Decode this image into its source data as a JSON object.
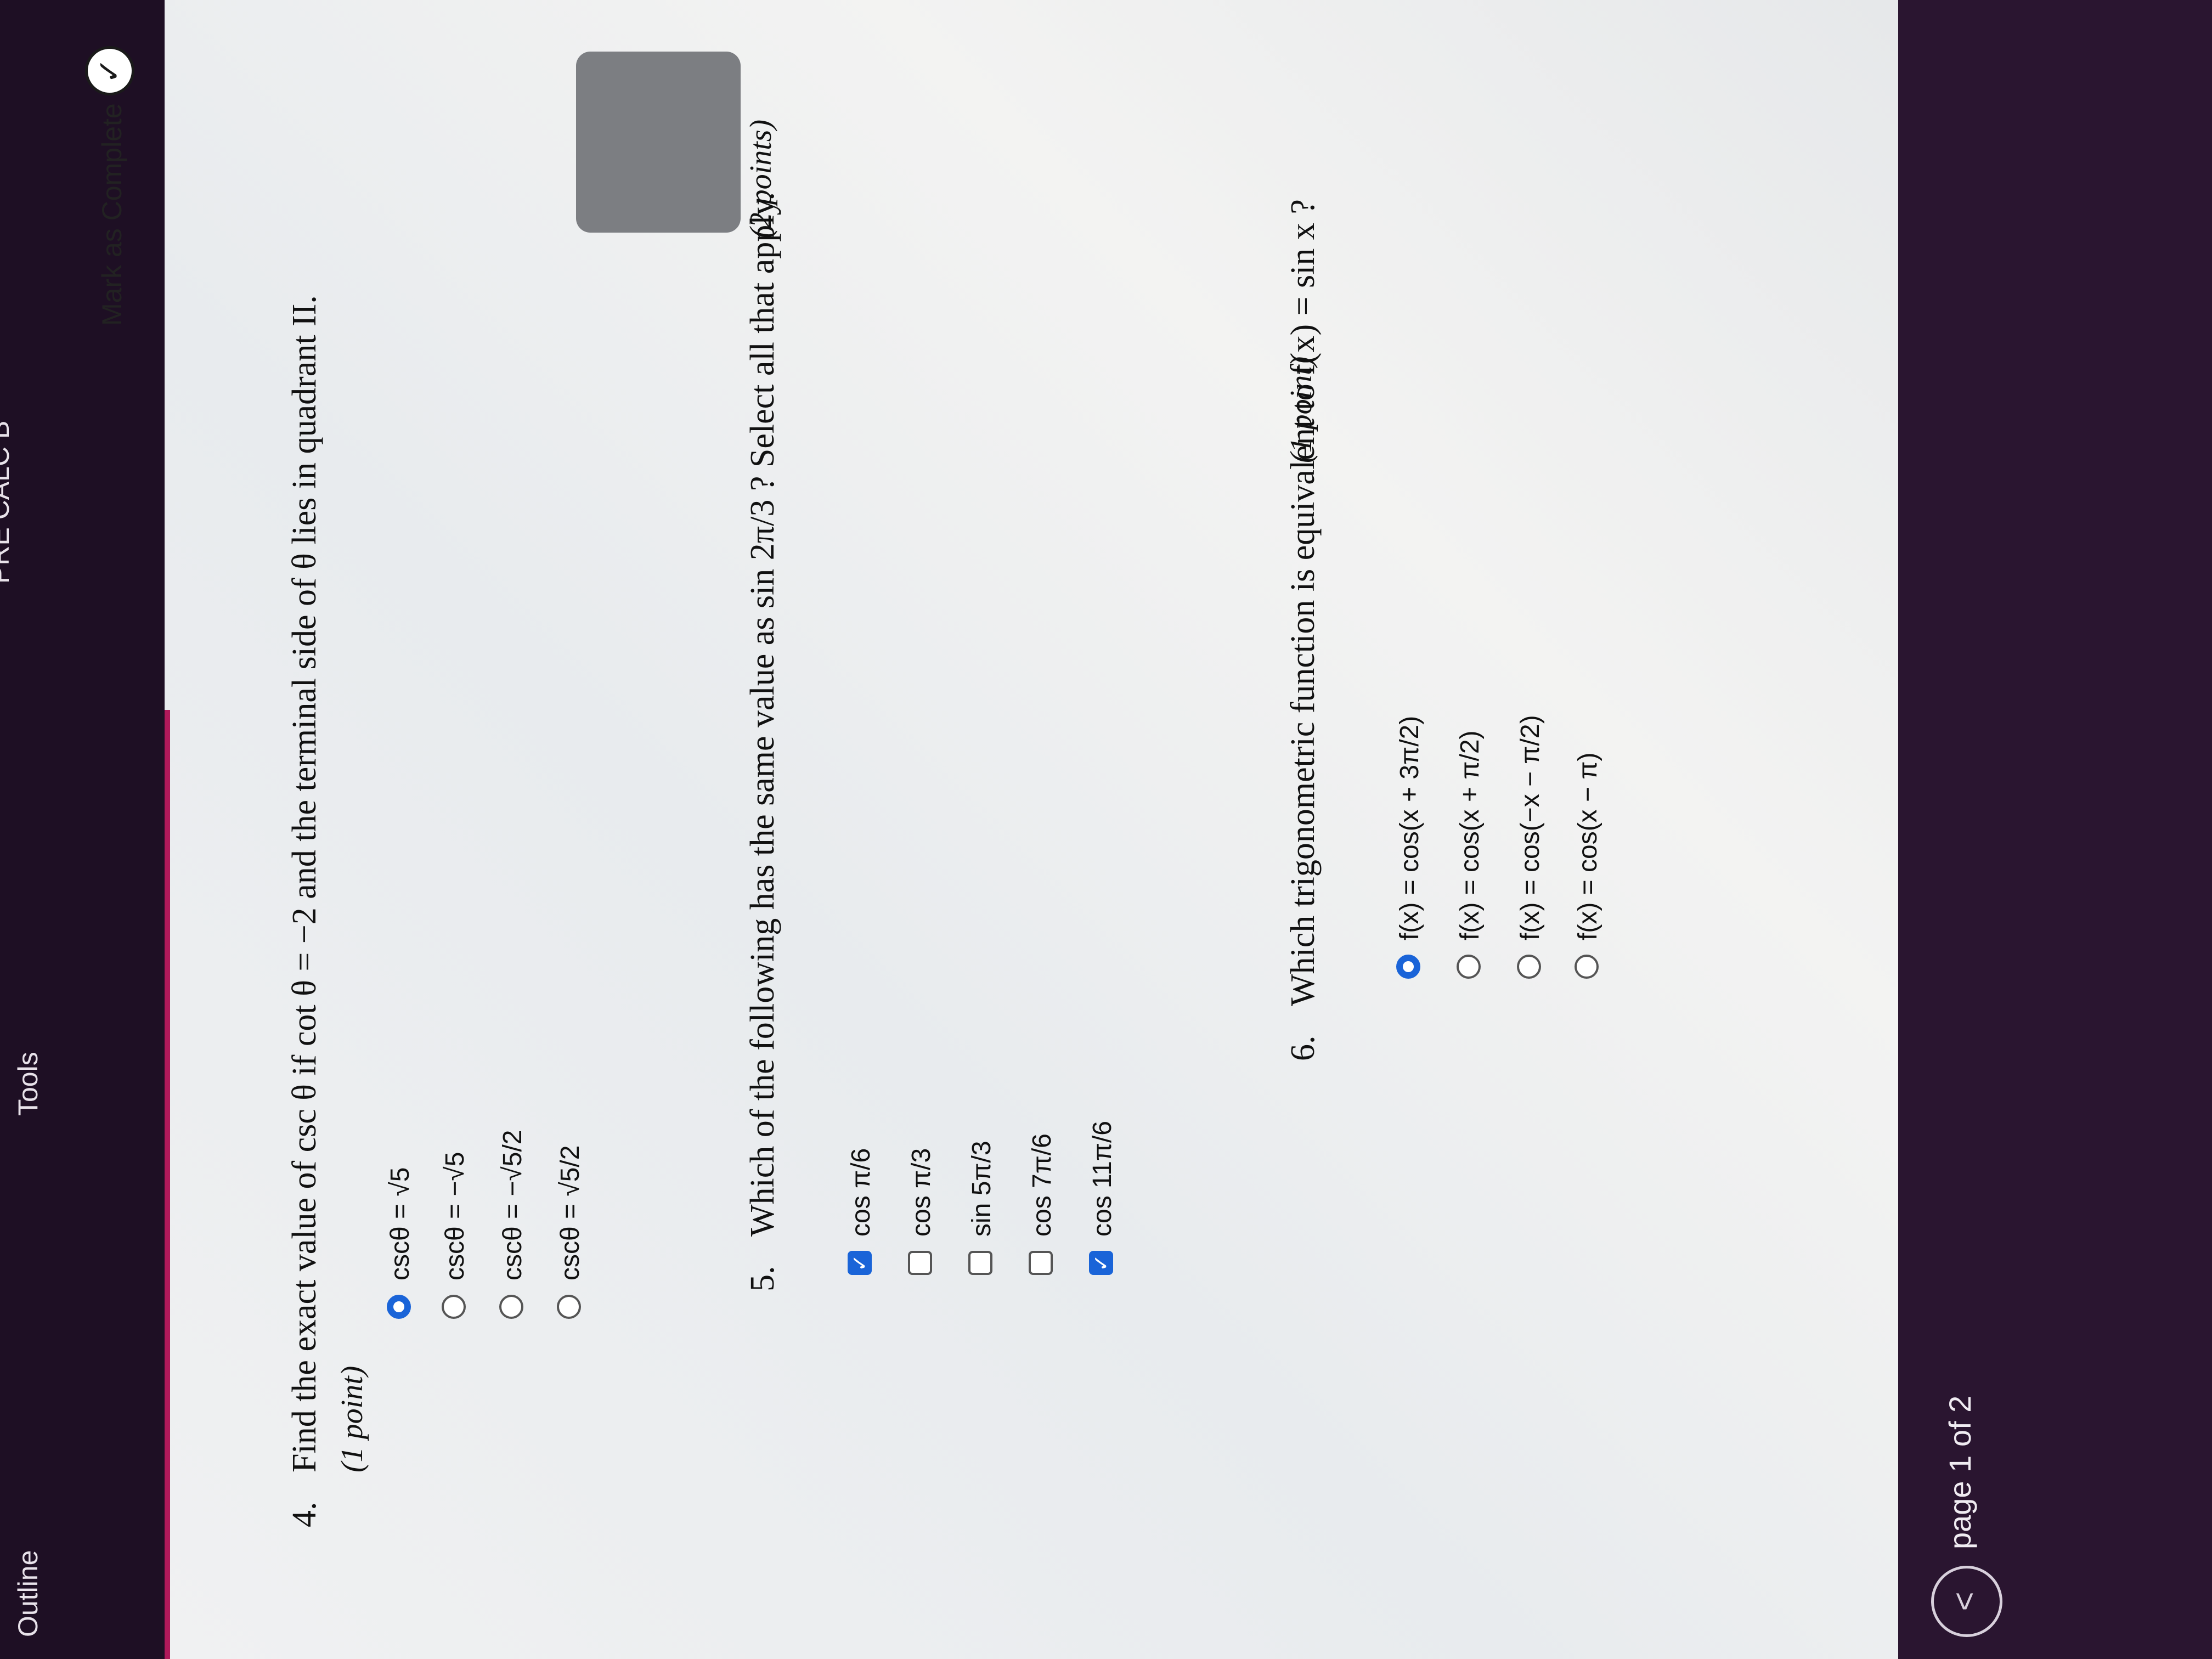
{
  "topbar": {
    "outline_label": "Outline",
    "tools_label": "Tools",
    "course_title": "PRE CALC B"
  },
  "header": {
    "mark_complete_label": "Mark as Complete",
    "check_icon": "check-circle-icon"
  },
  "questions": [
    {
      "number": "4.",
      "text": "Find the exact value of csc θ if cot θ = −2 and the terminal side of θ lies in quadrant II.",
      "points": "(1 point)",
      "type": "radio",
      "options": [
        {
          "label": "cscθ = √5",
          "selected": true
        },
        {
          "label": "cscθ = −√5",
          "selected": false
        },
        {
          "label": "cscθ = −√5/2",
          "selected": false
        },
        {
          "label": "cscθ = √5/2",
          "selected": false
        }
      ]
    },
    {
      "number": "5.",
      "text": "Which of the following has the same value as sin 2π/3 ? Select all that apply.",
      "points": "(2 points)",
      "type": "checkbox",
      "options": [
        {
          "label": "cos π/6",
          "selected": true
        },
        {
          "label": "cos π/3",
          "selected": false
        },
        {
          "label": "sin 5π/3",
          "selected": false
        },
        {
          "label": "cos 7π/6",
          "selected": false
        },
        {
          "label": "cos 11π/6",
          "selected": true
        }
      ]
    },
    {
      "number": "6.",
      "text": "Which trigonometric function is equivalent to f(x) = sin x ?",
      "points": "(1 point)",
      "type": "radio",
      "options": [
        {
          "label": "f(x) = cos(x + 3π/2)",
          "selected": true
        },
        {
          "label": "f(x) = cos(x + π/2)",
          "selected": false
        },
        {
          "label": "f(x) = cos(−x − π/2)",
          "selected": false
        },
        {
          "label": "f(x) = cos(x − π)",
          "selected": false
        }
      ]
    }
  ],
  "footer": {
    "prev_label": "<",
    "page_label": "page 1 of 2"
  },
  "colors": {
    "accent": "#b0195a",
    "selected": "#1a64d8",
    "topbar": "#1e0f24"
  }
}
